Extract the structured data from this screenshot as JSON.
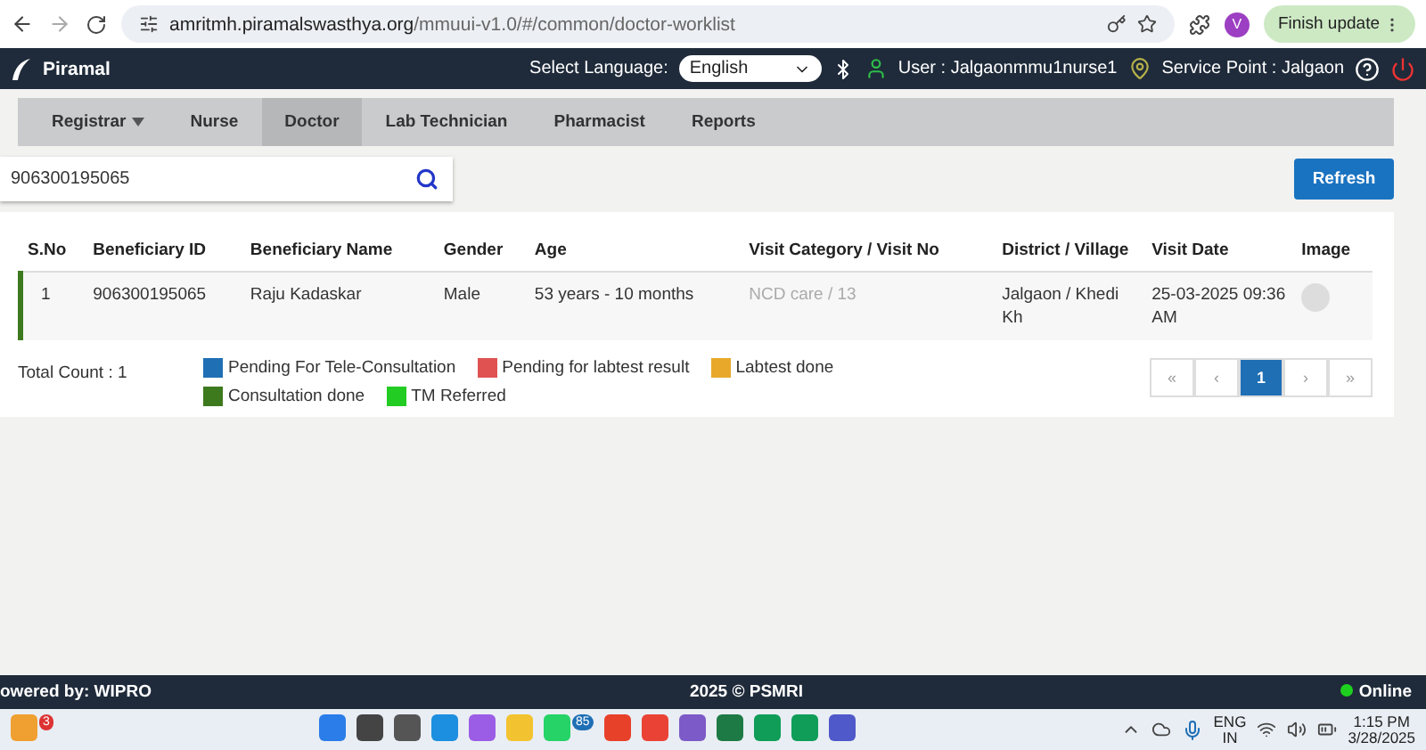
{
  "browser": {
    "url_host": "amritmh.piramalswasthya.org",
    "url_path": "/mmuui-v1.0/#/common/doctor-worklist",
    "profile": "V",
    "update_button": "Finish update"
  },
  "header": {
    "brand": "Piramal",
    "language_label": "Select Language:",
    "language": "English",
    "user": "User : Jalgaonmmu1nurse1",
    "service_point": "Service Point : Jalgaon"
  },
  "nav": [
    {
      "label": "Registrar",
      "dropdown": true,
      "selected": false
    },
    {
      "label": "Nurse",
      "dropdown": false,
      "selected": false
    },
    {
      "label": "Doctor",
      "dropdown": false,
      "selected": true
    },
    {
      "label": "Lab Technician",
      "dropdown": false,
      "selected": false
    },
    {
      "label": "Pharmacist",
      "dropdown": false,
      "selected": false
    },
    {
      "label": "Reports",
      "dropdown": false,
      "selected": false
    }
  ],
  "search": {
    "value": "906300195065"
  },
  "refresh_button": "Refresh",
  "table": {
    "columns": [
      "S.No",
      "Beneficiary ID",
      "Beneficiary Name",
      "Gender",
      "Age",
      "Visit Category / Visit No",
      "District / Village",
      "Visit Date",
      "Image"
    ],
    "rows": [
      {
        "sno": "1",
        "id": "906300195065",
        "name": "Raju Kadaskar",
        "gender": "Male",
        "age": "53 years - 10 months",
        "visit": "NCD care / 13",
        "district": "Jalgaon / Khedi Kh",
        "visit_date": "25-03-2025 09:36 AM",
        "color": "#3d7a1e"
      }
    ]
  },
  "total_count": "Total Count : 1",
  "legend": [
    {
      "label": "Pending For Tele-Consultation",
      "color": "#1f6fb5"
    },
    {
      "label": "Pending for labtest result",
      "color": "#e05252"
    },
    {
      "label": "Labtest done",
      "color": "#e8a92a"
    },
    {
      "label": "Consultation done",
      "color": "#3d7a1e"
    },
    {
      "label": "TM Referred",
      "color": "#22cc22"
    }
  ],
  "pagination": [
    {
      "label": "«",
      "selected": false
    },
    {
      "label": "‹",
      "selected": false
    },
    {
      "label": "1",
      "selected": true
    },
    {
      "label": "›",
      "selected": false
    },
    {
      "label": "»",
      "selected": false
    }
  ],
  "footer": {
    "left": "owered by: WIPRO",
    "center": "2025 © PSMRI",
    "status": "Online"
  },
  "taskbar": {
    "notification_badge": "3",
    "whatsapp_badge": "85",
    "language": "ENG",
    "region": "IN",
    "time": "1:15 PM",
    "date": "3/28/2025"
  }
}
